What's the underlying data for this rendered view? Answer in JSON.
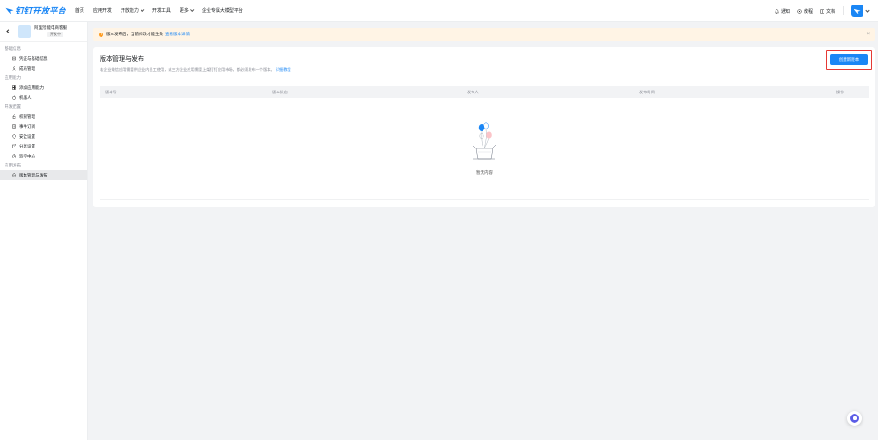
{
  "topbar": {
    "logo_text": "钉钉开放平台",
    "nav": [
      {
        "label": "首页",
        "dropdown": false
      },
      {
        "label": "应用开发",
        "dropdown": false
      },
      {
        "label": "开放能力",
        "dropdown": true
      },
      {
        "label": "开发工具",
        "dropdown": false
      },
      {
        "label": "更多",
        "dropdown": true
      },
      {
        "label": "企业专属大模型平台",
        "dropdown": false
      }
    ],
    "right": {
      "notify_label": "通知",
      "tutorial_label": "教程",
      "docs_label": "文档"
    }
  },
  "sidebar": {
    "app_name": "阿里智能电商客服",
    "app_status": "开发中",
    "groups": [
      {
        "title": "基础信息",
        "items": [
          {
            "label": "凭证与基础信息",
            "icon": "credential-icon"
          },
          {
            "label": "成员管理",
            "icon": "member-icon"
          }
        ]
      },
      {
        "title": "应用能力",
        "items": [
          {
            "label": "添加应用能力",
            "icon": "add-capability-icon"
          },
          {
            "label": "机器人",
            "icon": "robot-icon"
          }
        ]
      },
      {
        "title": "开发配置",
        "items": [
          {
            "label": "权限管理",
            "icon": "permission-icon"
          },
          {
            "label": "事件订阅",
            "icon": "event-icon"
          },
          {
            "label": "安全设置",
            "icon": "security-icon"
          },
          {
            "label": "分享设置",
            "icon": "share-icon"
          },
          {
            "label": "监控中心",
            "icon": "monitor-icon"
          }
        ]
      },
      {
        "title": "应用发布",
        "items": [
          {
            "label": "版本管理与发布",
            "icon": "version-icon",
            "active": true
          }
        ]
      }
    ]
  },
  "notice": {
    "text": "版本发布后，当前修改才能生效",
    "link": "查看版本详情"
  },
  "main": {
    "title": "版本管理与发布",
    "desc": "若企业微信应用需要供企业内员工使用，或三方企业应用需要上架钉钉应用市场，都必须发布一个版本。",
    "desc_link": "详细教程",
    "create_button": "创建新版本",
    "columns": [
      "版本号",
      "版本状态",
      "发布人",
      "发布时间",
      "操作"
    ],
    "empty_text": "暂无内容"
  },
  "colors": {
    "brand": "#1a86f5",
    "notice_bg": "#fff4e5",
    "highlight": "#e53935"
  }
}
